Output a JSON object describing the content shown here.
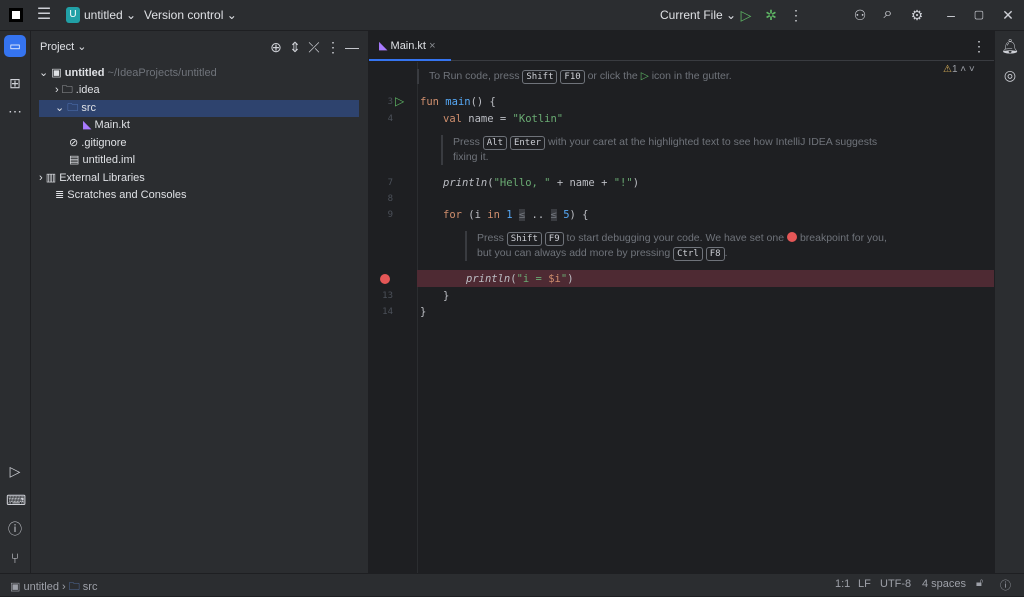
{
  "titlebar": {
    "project_badge": "U",
    "project": "untitled",
    "vcs": "Version control",
    "run_config": "Current File"
  },
  "project_panel": {
    "title": "Project",
    "tree": [
      {
        "label": "untitled",
        "path": "~/IdeaProjects/untitled"
      },
      {
        "label": ".idea"
      },
      {
        "label": "src"
      },
      {
        "label": "Main.kt"
      },
      {
        "label": ".gitignore"
      },
      {
        "label": "untitled.iml"
      },
      {
        "label": "External Libraries"
      },
      {
        "label": "Scratches and Consoles"
      }
    ]
  },
  "editor": {
    "tab": "Main.kt",
    "warnings": "1",
    "hint_run": {
      "a": "To Run code, press",
      "k1": "Shift",
      "k2": "F10",
      "b": "or click the",
      "c": "icon in the gutter."
    },
    "hint_alt": {
      "a": "Press",
      "k1": "Alt",
      "k2": "Enter",
      "b": "with your caret at the highlighted text to see how IntelliJ IDEA suggests",
      "c": "fixing it."
    },
    "hint_debug": {
      "a": "Press",
      "k1": "Shift",
      "k2": "F9",
      "b": "to start debugging your code. We have set one",
      "c": "breakpoint for you,",
      "d": "but you can always add more by pressing",
      "k3": "Ctrl",
      "k4": "F8",
      "e": "."
    },
    "line_numbers": {
      "l3": "3",
      "l4": "4",
      "l7": "7",
      "l8": "8",
      "l9": "9",
      "l13": "13",
      "l14": "14"
    }
  },
  "statusbar": {
    "crumb1": "untitled",
    "crumb2": "src",
    "position": "1:1",
    "line_sep": "LF",
    "encoding": "UTF-8",
    "indent": "4 spaces"
  },
  "colors": {
    "accent": "#3574f0",
    "breakpoint": "#e55757",
    "breakpoint_line": "#4e2a33",
    "selection": "#2e436e"
  }
}
